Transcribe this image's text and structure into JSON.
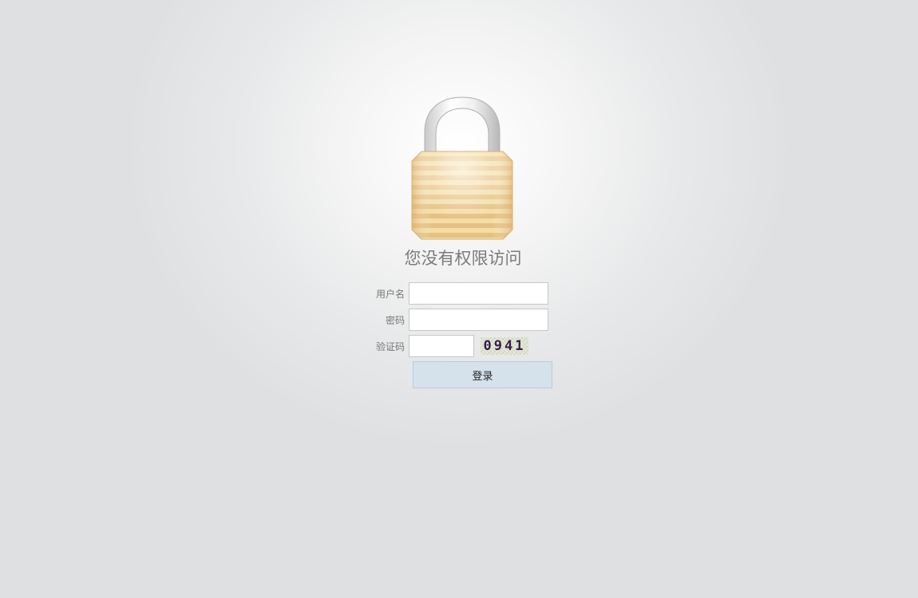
{
  "header": {
    "title": "您没有权限访问"
  },
  "form": {
    "username_label": "用户名",
    "username_value": "",
    "password_label": "密码",
    "password_value": "",
    "captcha_label": "验证码",
    "captcha_value": "",
    "captcha_image_text": "0941",
    "login_label": "登录"
  },
  "icons": {
    "lock": "lock-icon"
  },
  "colors": {
    "button_bg": "#d5e2ec",
    "title_text": "#7b7b7b",
    "lock_body": "#eacb8e"
  }
}
